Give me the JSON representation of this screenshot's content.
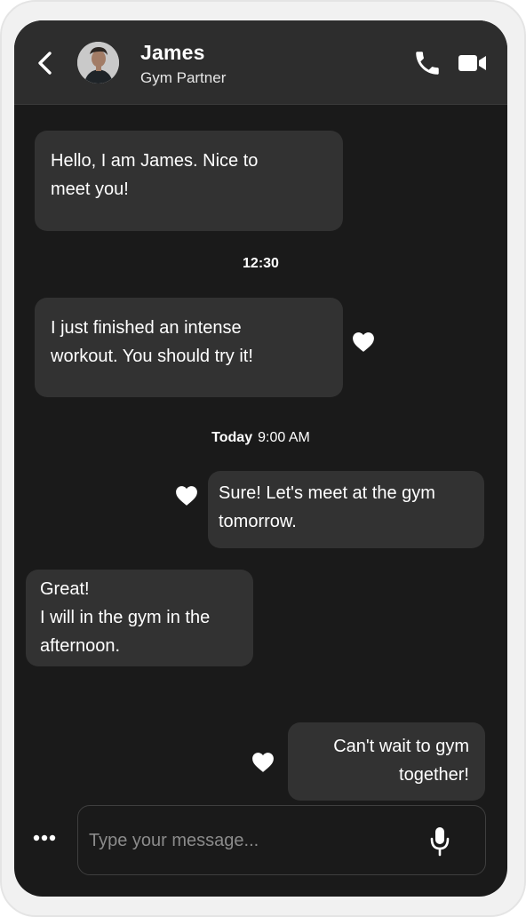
{
  "contact": {
    "name": "James",
    "role": "Gym Partner"
  },
  "icons": {
    "back": "chevron-left-icon",
    "call": "phone-icon",
    "video": "video-camera-icon",
    "like": "heart-icon",
    "more": "ellipsis-icon",
    "mic": "microphone-icon"
  },
  "messages": [
    {
      "side": "left",
      "text": "Hello, I am James. Nice to\nmeet you!"
    },
    {
      "side": "left",
      "text": "I just finished an intense\nworkout. You should try it!",
      "liked": true
    },
    {
      "side": "right",
      "text": "Sure! Let's meet at the gym\ntomorrow.",
      "liked": true
    },
    {
      "side": "left",
      "text": "Great!\nI will in the gym in the\nafternoon."
    },
    {
      "side": "right",
      "text": "Can't wait to gym\ntogether!",
      "liked": true
    }
  ],
  "timestamps": {
    "first": "12:30",
    "second_day": "Today",
    "second_time": "9:00 AM"
  },
  "composer": {
    "placeholder": "Type your message...",
    "value": ""
  },
  "colors": {
    "screen_bg": "#1a1a1a",
    "header_bg": "#2d2d2d",
    "bubble_bg": "#323232",
    "text": "#ffffff"
  }
}
